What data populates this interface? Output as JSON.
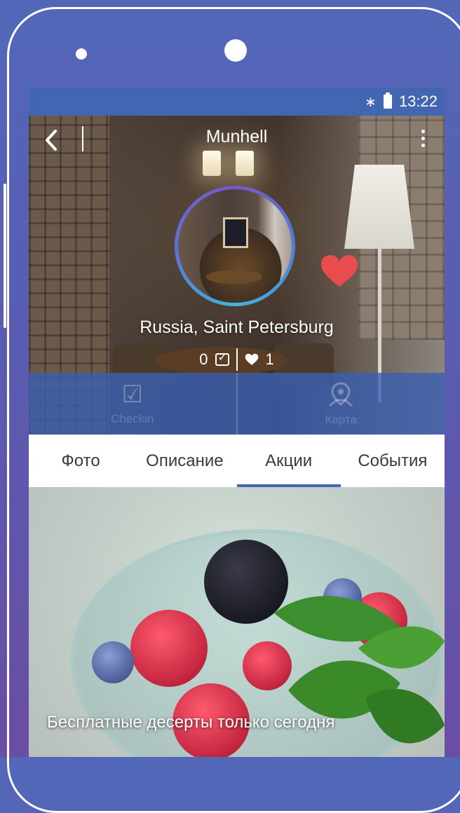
{
  "status_bar": {
    "time": "13:22",
    "bluetooth_icon": "bluetooth-icon",
    "battery_icon": "battery-icon"
  },
  "toolbar": {
    "title": "Munhell"
  },
  "venue": {
    "location": "Russia, Saint Petersburg",
    "checkins": "0",
    "likes": "1"
  },
  "actions": [
    {
      "label": "Checkin",
      "icon": "checkin-icon"
    },
    {
      "label": "Карта",
      "icon": "map-pin-icon"
    }
  ],
  "tabs": [
    {
      "label": "Фото",
      "active": false
    },
    {
      "label": "Описание",
      "active": false
    },
    {
      "label": "Акции",
      "active": true
    },
    {
      "label": "События",
      "active": false
    }
  ],
  "promo": {
    "caption": "Бесплатные десерты только сегодня"
  },
  "colors": {
    "accent": "#4366b2",
    "heart": "#e84c4c",
    "background": "#5a5bb0"
  }
}
